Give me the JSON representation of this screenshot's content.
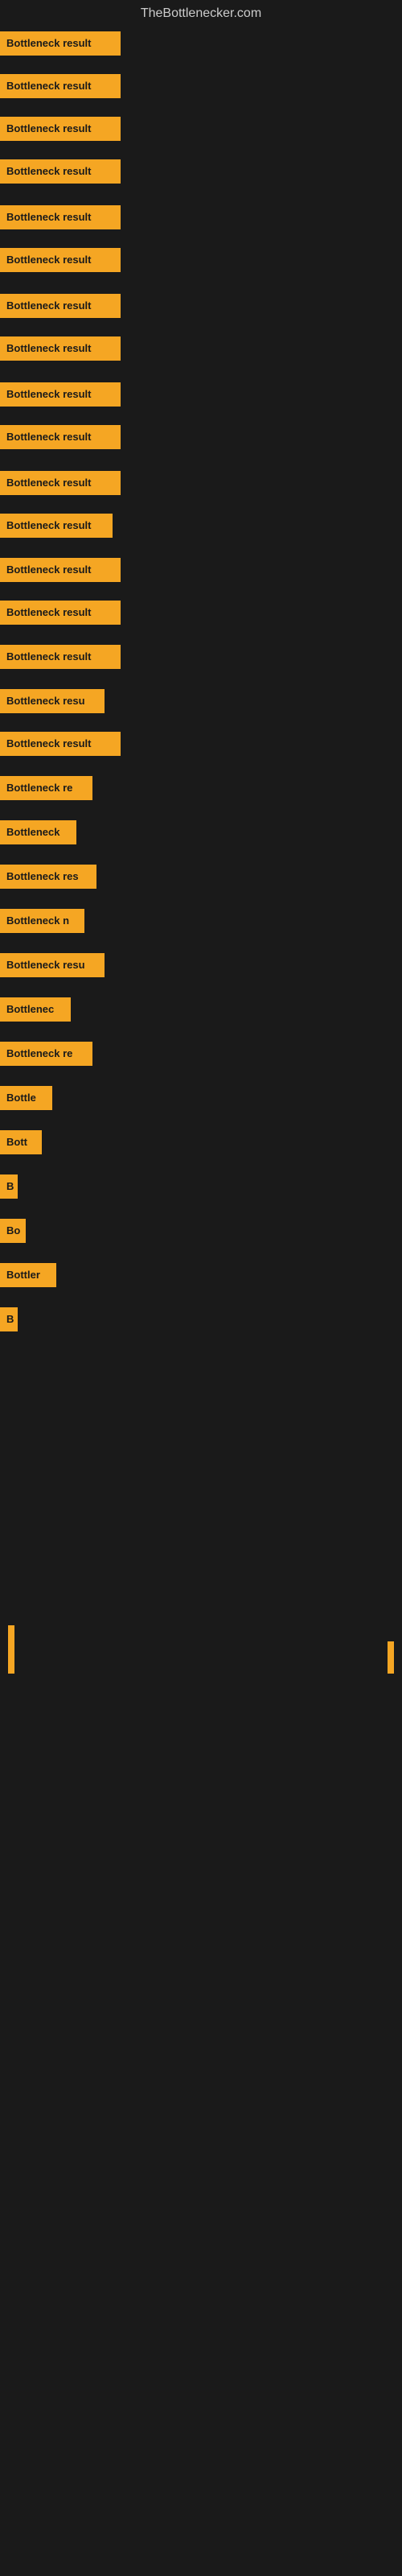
{
  "site": {
    "title": "TheBottlenecker.com"
  },
  "bars": [
    {
      "label": "Bottleneck result",
      "width": 150,
      "marginTop": 5
    },
    {
      "label": "Bottleneck result",
      "width": 150,
      "marginTop": 18
    },
    {
      "label": "Bottleneck result",
      "width": 150,
      "marginTop": 18
    },
    {
      "label": "Bottleneck result",
      "width": 150,
      "marginTop": 18
    },
    {
      "label": "Bottleneck result",
      "width": 150,
      "marginTop": 22
    },
    {
      "label": "Bottleneck result",
      "width": 150,
      "marginTop": 18
    },
    {
      "label": "Bottleneck result",
      "width": 150,
      "marginTop": 22
    },
    {
      "label": "Bottleneck result",
      "width": 150,
      "marginTop": 18
    },
    {
      "label": "Bottleneck result",
      "width": 150,
      "marginTop": 22
    },
    {
      "label": "Bottleneck result",
      "width": 150,
      "marginTop": 18
    },
    {
      "label": "Bottleneck result",
      "width": 150,
      "marginTop": 22
    },
    {
      "label": "Bottleneck result",
      "width": 140,
      "marginTop": 18
    },
    {
      "label": "Bottleneck result",
      "width": 150,
      "marginTop": 20
    },
    {
      "label": "Bottleneck result",
      "width": 150,
      "marginTop": 18
    },
    {
      "label": "Bottleneck result",
      "width": 150,
      "marginTop": 20
    },
    {
      "label": "Bottleneck resu",
      "width": 130,
      "marginTop": 20
    },
    {
      "label": "Bottleneck result",
      "width": 150,
      "marginTop": 18
    },
    {
      "label": "Bottleneck re",
      "width": 115,
      "marginTop": 20
    },
    {
      "label": "Bottleneck",
      "width": 95,
      "marginTop": 20
    },
    {
      "label": "Bottleneck res",
      "width": 120,
      "marginTop": 20
    },
    {
      "label": "Bottleneck n",
      "width": 105,
      "marginTop": 20
    },
    {
      "label": "Bottleneck resu",
      "width": 130,
      "marginTop": 20
    },
    {
      "label": "Bottlenec",
      "width": 88,
      "marginTop": 20
    },
    {
      "label": "Bottleneck re",
      "width": 115,
      "marginTop": 20
    },
    {
      "label": "Bottle",
      "width": 65,
      "marginTop": 20
    },
    {
      "label": "Bott",
      "width": 52,
      "marginTop": 20
    },
    {
      "label": "B",
      "width": 22,
      "marginTop": 20
    },
    {
      "label": "Bo",
      "width": 32,
      "marginTop": 20
    },
    {
      "label": "Bottler",
      "width": 70,
      "marginTop": 20
    },
    {
      "label": "B",
      "width": 22,
      "marginTop": 20
    }
  ],
  "accent_color": "#f5a623",
  "bg_color": "#1a1a1a",
  "text_color": "#cccccc"
}
